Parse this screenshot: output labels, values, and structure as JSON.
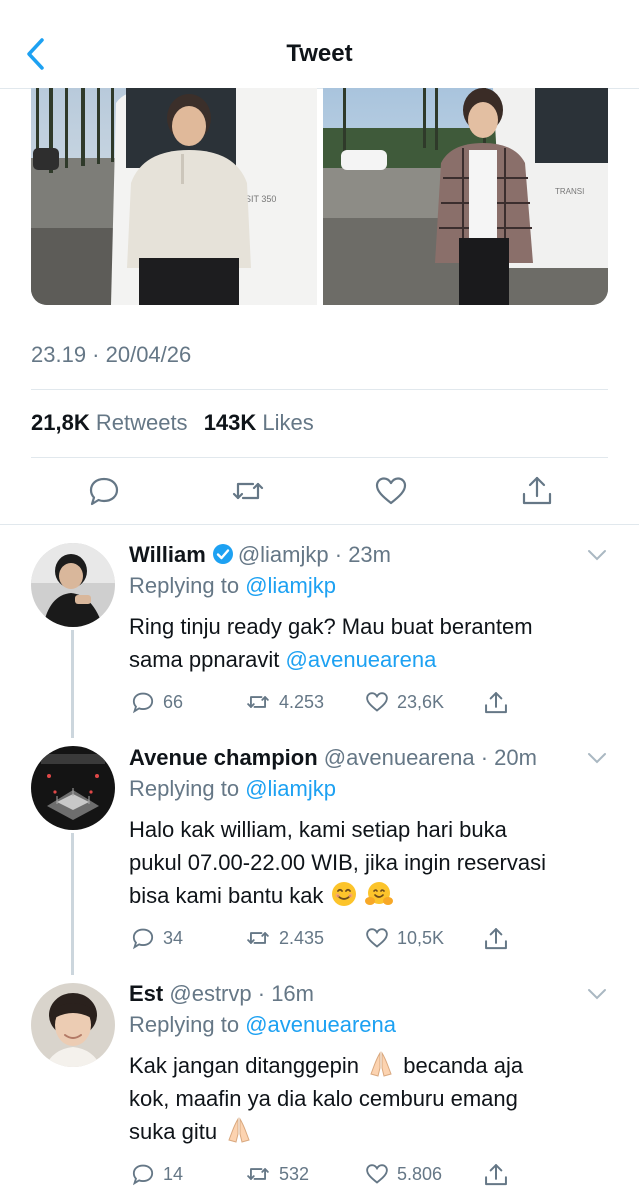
{
  "header": {
    "title": "Tweet"
  },
  "tweet": {
    "timestamp": "23.19 · 20/04/26",
    "retweets_count": "21,8K",
    "retweets_label": "Retweets",
    "likes_count": "143K",
    "likes_label": "Likes",
    "photo_left_text": "SIT 350",
    "photo_right_text": "TRANSI"
  },
  "replies": [
    {
      "name": "William",
      "verified": true,
      "handle": "@liamjkp",
      "time": "23m",
      "replying_prefix": "Replying to",
      "replying_to": "@liamjkp",
      "text_line1": "Ring tinju ready gak? Mau buat berantem",
      "text_line2a": "sama ppnaravit ",
      "text_mention": "@avenuearena",
      "comments": "66",
      "retweets": "4.253",
      "likes": "23,6K"
    },
    {
      "name": "Avenue champion",
      "handle": "@avenuearena",
      "time": "20m",
      "replying_prefix": "Replying to",
      "replying_to": "@liamjkp",
      "text_line1": "Halo kak william, kami setiap hari buka",
      "text_line2": "pukul 07.00-22.00 WIB, jika ingin reservasi",
      "text_line3": "bisa kami bantu kak",
      "comments": "34",
      "retweets": "2.435",
      "likes": "10,5K"
    },
    {
      "name": "Est",
      "handle": "@estrvp",
      "time": "16m",
      "replying_prefix": "Replying to",
      "replying_to": "@avenuearena",
      "text_line1": "Kak jangan ditanggepin",
      "text_line1b": "becanda aja",
      "text_line2": "kok, maafin ya dia kalo cemburu emang",
      "text_line3": "suka gitu",
      "comments": "14",
      "retweets": "532",
      "likes": "5.806"
    }
  ],
  "colors": {
    "accent": "#1da1f2",
    "secondary_text": "#657786",
    "divider": "#e1e8ed"
  }
}
